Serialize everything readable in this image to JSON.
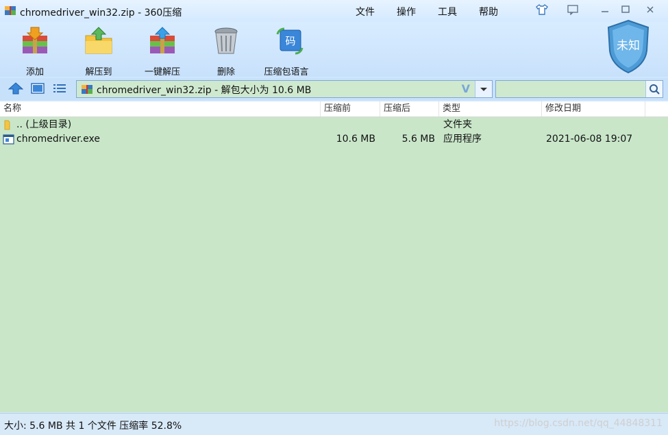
{
  "window": {
    "title": "chromedriver_win32.zip - 360压缩",
    "menus": [
      "文件",
      "操作",
      "工具",
      "帮助"
    ]
  },
  "toolbar": {
    "add": "添加",
    "extract_to": "解压到",
    "one_click_extract": "一键解压",
    "delete": "删除",
    "archive_language": "压缩包语言",
    "language_badge": "码"
  },
  "shield": {
    "label": "未知"
  },
  "address": {
    "path": "chromedriver_win32.zip - 解包大小为 10.6 MB",
    "search_placeholder": ""
  },
  "columns": {
    "name": "名称",
    "compressed_before": "压缩前",
    "compressed_after": "压缩后",
    "type": "类型",
    "modified": "修改日期"
  },
  "files": [
    {
      "name": ".. (上级目录)",
      "before": "",
      "after": "",
      "type": "文件夹",
      "modified": "",
      "icon": "folder-icon"
    },
    {
      "name": "chromedriver.exe",
      "before": "10.6 MB",
      "after": "5.6 MB",
      "type": "应用程序",
      "modified": "2021-06-08 19:07",
      "icon": "exe-icon"
    }
  ],
  "status": {
    "summary": "大小: 5.6 MB 共 1 个文件 压缩率 52.8%",
    "watermark": "https://blog.csdn.net/qq_44848311"
  },
  "colors": {
    "list_bg": "#c9e6c9",
    "chrome_bg": "#cfe6ff",
    "accent": "#2f76c9"
  }
}
